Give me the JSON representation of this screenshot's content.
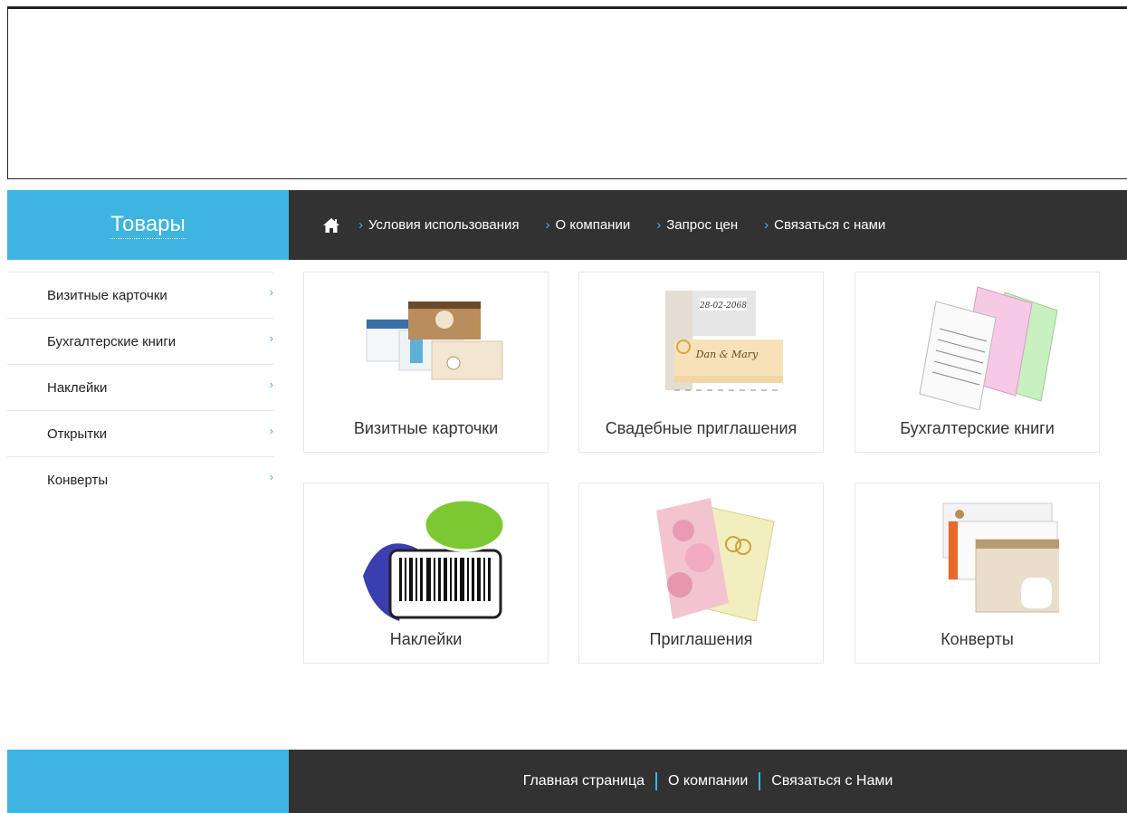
{
  "nav": {
    "category_title": "Товары",
    "links": [
      {
        "label": "Условия использования"
      },
      {
        "label": "О компании"
      },
      {
        "label": "Запрос цен"
      },
      {
        "label": "Связаться с нами"
      }
    ]
  },
  "sidebar": {
    "items": [
      {
        "label": "Визитные карточки"
      },
      {
        "label": "Бухгалтерские книги"
      },
      {
        "label": "Наклейки"
      },
      {
        "label": "Открытки"
      },
      {
        "label": "Конверты"
      }
    ]
  },
  "products": [
    {
      "label": "Визитные карточки"
    },
    {
      "label": "Свадебные приглашения"
    },
    {
      "label": "Бухгалтерские книги"
    },
    {
      "label": "Наклейки"
    },
    {
      "label": "Приглашения"
    },
    {
      "label": "Конверты"
    }
  ],
  "footer": {
    "links": [
      {
        "label": "Главная страница"
      },
      {
        "label": "О компании"
      },
      {
        "label": "Связаться с Нами"
      }
    ]
  },
  "colors": {
    "accent": "#3db5e0",
    "dark": "#323232"
  },
  "icons": {
    "home": "home-icon",
    "arrow": "chevron-right-icon"
  }
}
